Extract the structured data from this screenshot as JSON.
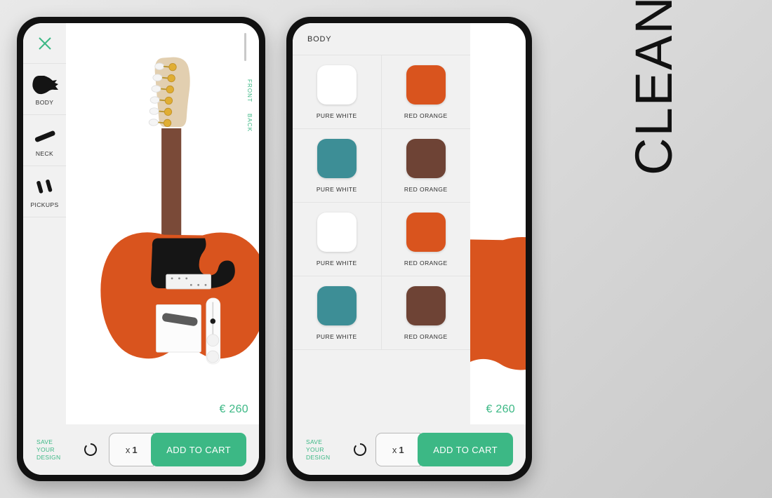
{
  "brand": {
    "wordmark": "CLEAN"
  },
  "theme": {
    "accent_green": "#3cb885",
    "panel_bg": "#f1f1f1",
    "canvas_bg": "#ffffff",
    "page_bg": "#dcdcdc",
    "body_orange": "#d9541e",
    "neck_brown": "#7a4a38",
    "headstock_cream": "#e2cfb0",
    "pickguard_black": "#151515"
  },
  "phone_1": {
    "rail": {
      "close_icon": "close-x-icon",
      "items": [
        {
          "label": "Body",
          "icon": "guitar-body-icon"
        },
        {
          "label": "Neck",
          "icon": "guitar-neck-icon"
        },
        {
          "label": "Pickups",
          "icon": "guitar-pickups-icon"
        }
      ]
    },
    "canvas": {
      "price": "€ 260",
      "view_tabs": [
        {
          "label": "Front",
          "active": true
        },
        {
          "label": "Back",
          "active": false
        }
      ],
      "product": "electric-guitar-telecaster"
    },
    "bottom": {
      "save_label": "Save\nYour\nDesign",
      "save_lines": [
        "Save",
        "Your",
        "Design"
      ],
      "reset_icon": "reset-circle-icon",
      "quantity_prefix": "x",
      "quantity_value": "1",
      "add_to_cart_label": "Add to cart"
    }
  },
  "phone_2": {
    "panel": {
      "title": "Body",
      "swatches": [
        {
          "name": "Pure White",
          "hex": "#ffffff"
        },
        {
          "name": "Red Orange",
          "hex": "#d9541e"
        },
        {
          "name": "Pure White",
          "hex": "#3d8e96"
        },
        {
          "name": "Red Orange",
          "hex": "#6e4335"
        },
        {
          "name": "Pure White",
          "hex": "#ffffff"
        },
        {
          "name": "Red Orange",
          "hex": "#d9541e"
        },
        {
          "name": "Pure White",
          "hex": "#3d8e96"
        },
        {
          "name": "Red Orange",
          "hex": "#6e4335"
        }
      ]
    },
    "canvas": {
      "price": "€ 260"
    },
    "bottom": {
      "save_lines": [
        "Save",
        "Your",
        "Design"
      ],
      "reset_icon": "reset-circle-icon",
      "quantity_prefix": "x",
      "quantity_value": "1",
      "add_to_cart_label": "Add to cart"
    }
  }
}
